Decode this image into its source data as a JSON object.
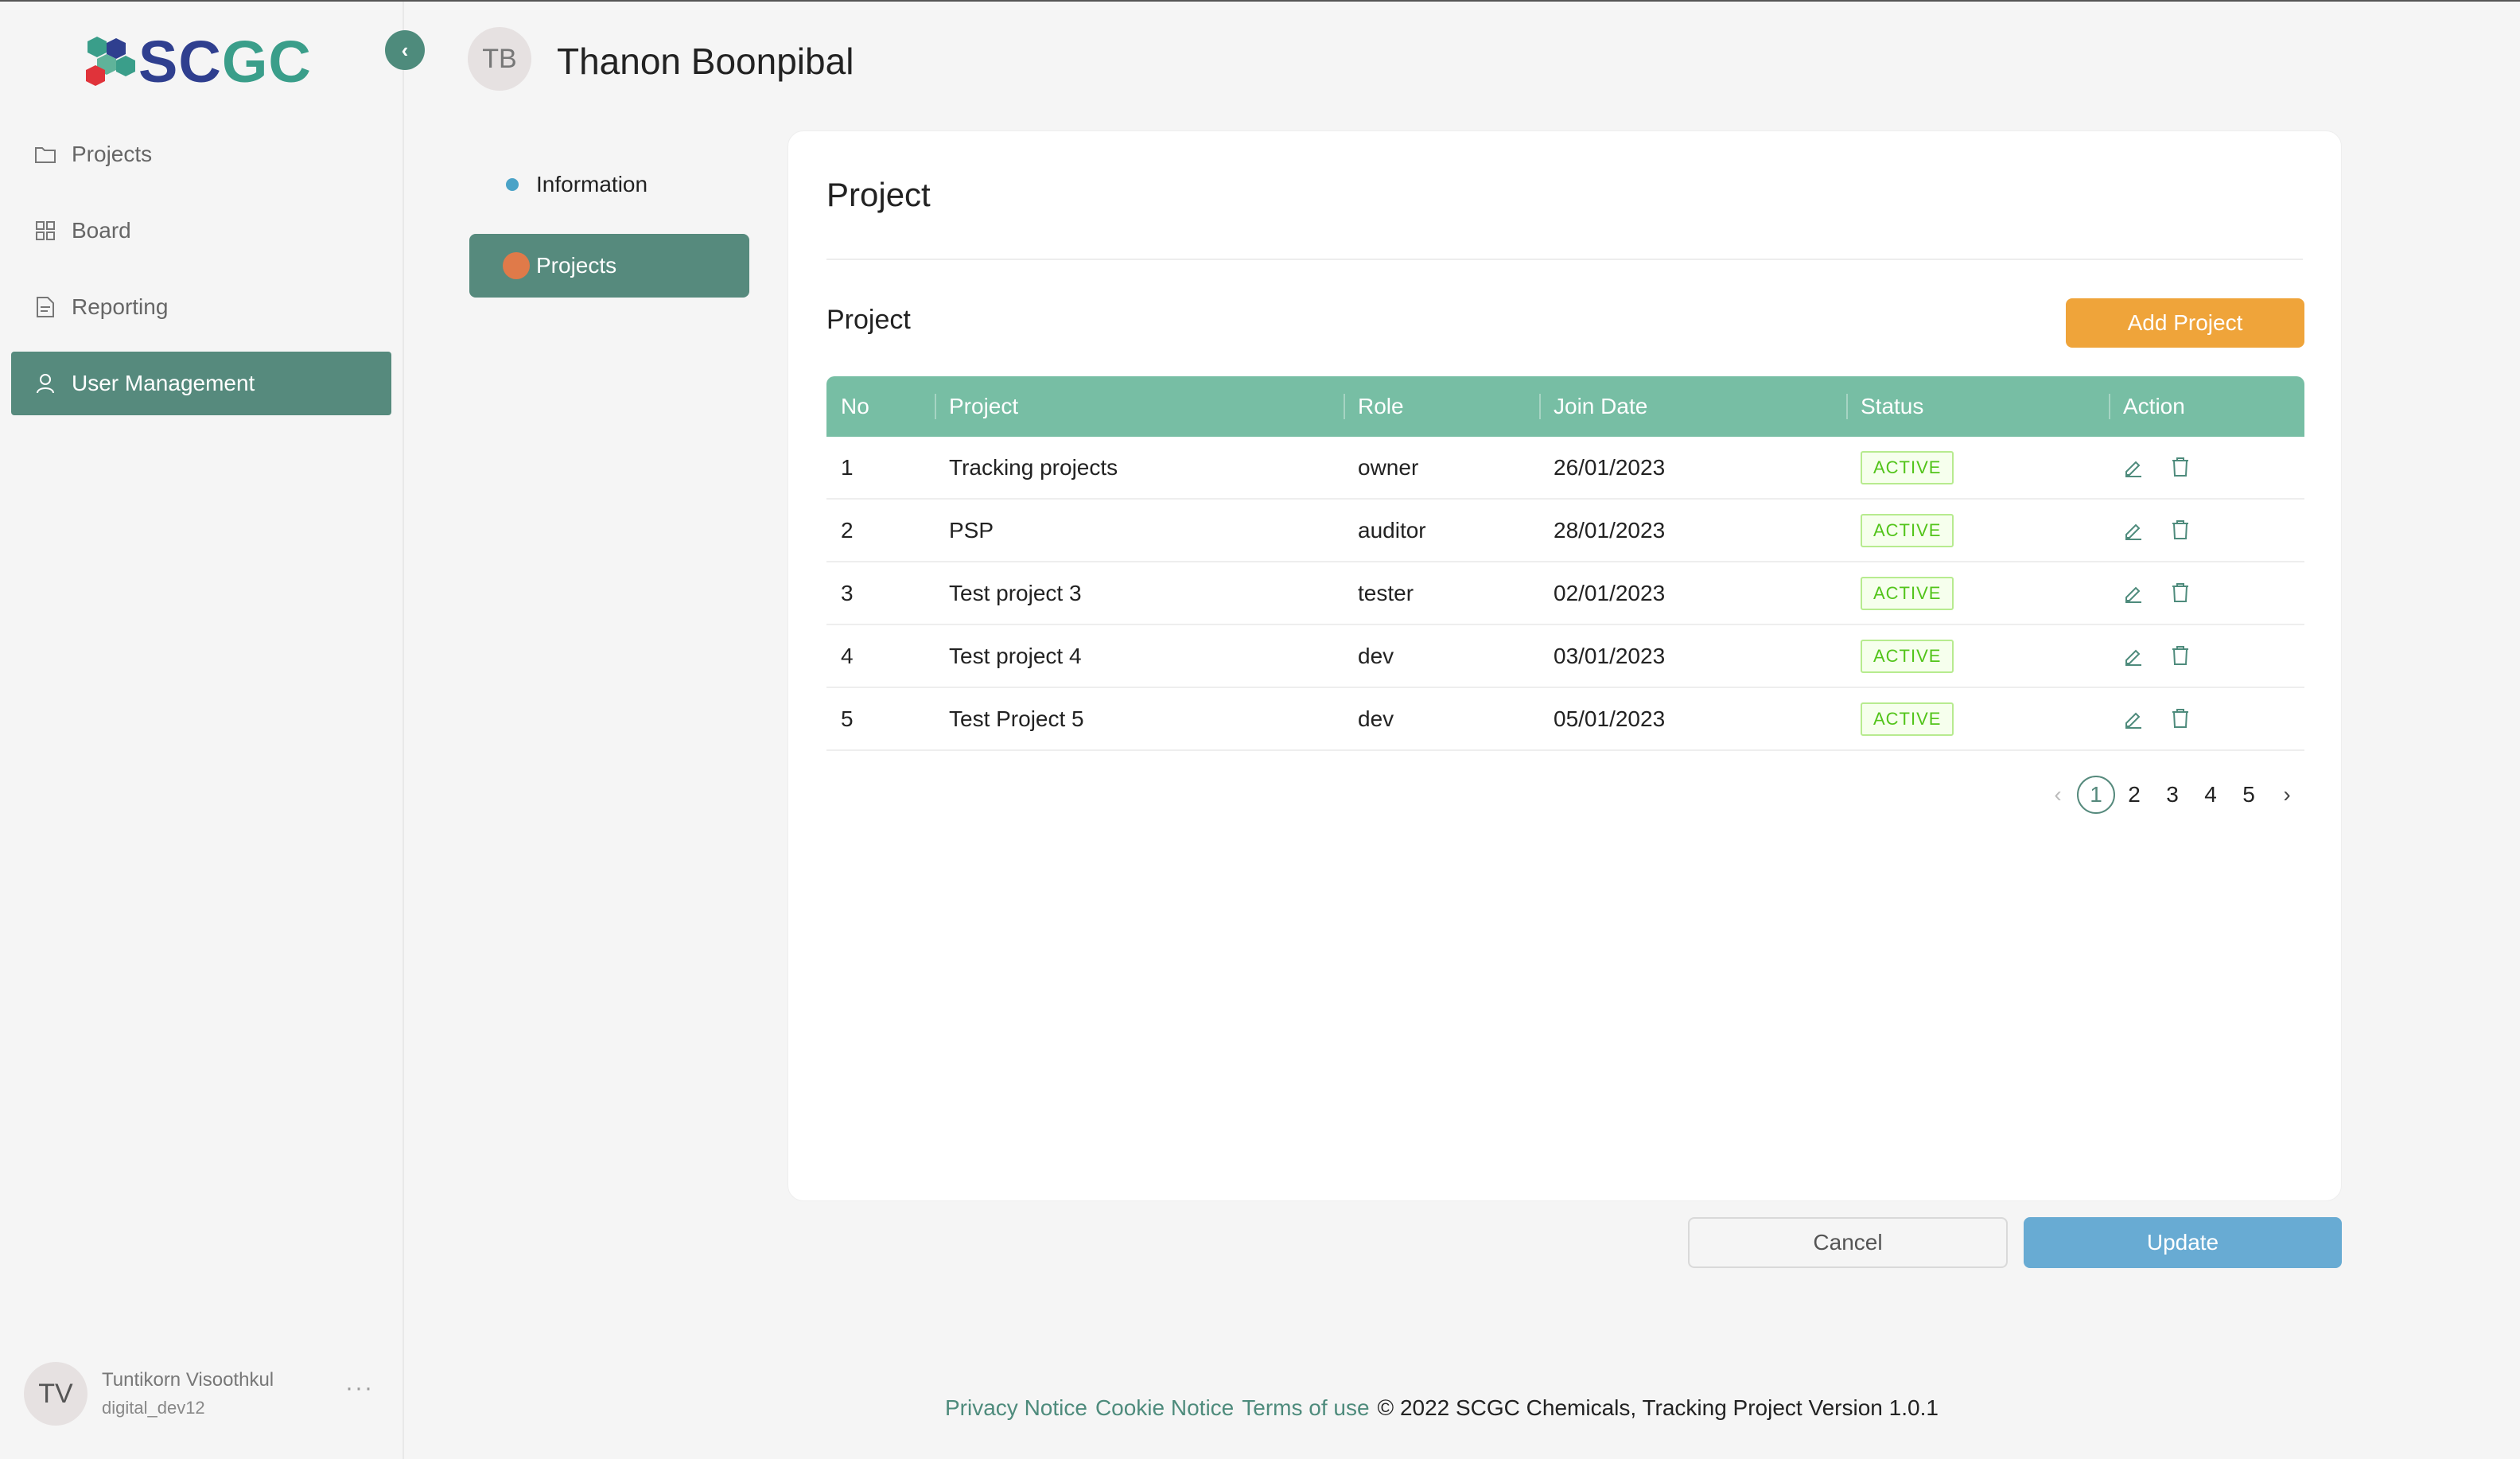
{
  "brand": {
    "logo_text_a": "SC",
    "logo_text_b": "G",
    "logo_text_c": "C"
  },
  "sidebar": {
    "items": [
      {
        "label": "Projects",
        "icon": "folder-icon",
        "active": false
      },
      {
        "label": "Board",
        "icon": "grid-icon",
        "active": false
      },
      {
        "label": "Reporting",
        "icon": "document-icon",
        "active": false
      },
      {
        "label": "User Management",
        "icon": "user-icon",
        "active": true
      }
    ],
    "user": {
      "initials": "TV",
      "name": "Tuntikorn Visoothkul",
      "id": "digital_dev12",
      "more": "···"
    }
  },
  "header": {
    "initials": "TB",
    "name": "Thanon Boonpibal"
  },
  "subnav": {
    "information": "Information",
    "projects": "Projects"
  },
  "card": {
    "title": "Project",
    "section_title": "Project",
    "add_button": "Add Project",
    "columns": [
      "No",
      "Project",
      "Role",
      "Join Date",
      "Status",
      "Action"
    ],
    "rows": [
      {
        "no": "1",
        "project": "Tracking projects",
        "role": "owner",
        "join_date": "26/01/2023",
        "status": "ACTIVE"
      },
      {
        "no": "2",
        "project": "PSP",
        "role": "auditor",
        "join_date": "28/01/2023",
        "status": "ACTIVE"
      },
      {
        "no": "3",
        "project": "Test project 3",
        "role": "tester",
        "join_date": "02/01/2023",
        "status": "ACTIVE"
      },
      {
        "no": "4",
        "project": "Test project 4",
        "role": "dev",
        "join_date": "03/01/2023",
        "status": "ACTIVE"
      },
      {
        "no": "5",
        "project": "Test Project 5",
        "role": "dev",
        "join_date": "05/01/2023",
        "status": "ACTIVE"
      }
    ],
    "pagination": {
      "prev": "‹",
      "pages": [
        "1",
        "2",
        "3",
        "4",
        "5"
      ],
      "current": "1",
      "next": "›"
    }
  },
  "actions": {
    "cancel": "Cancel",
    "update": "Update"
  },
  "footer": {
    "privacy": "Privacy Notice",
    "cookie": "Cookie Notice",
    "terms": "Terms of use",
    "copyright": "© 2022 SCGC Chemicals, Tracking Project Version 1.0.1"
  },
  "colors": {
    "primary": "#568a7d",
    "header_row": "#77bea4",
    "accent": "#efa43a",
    "update": "#68abd3"
  }
}
